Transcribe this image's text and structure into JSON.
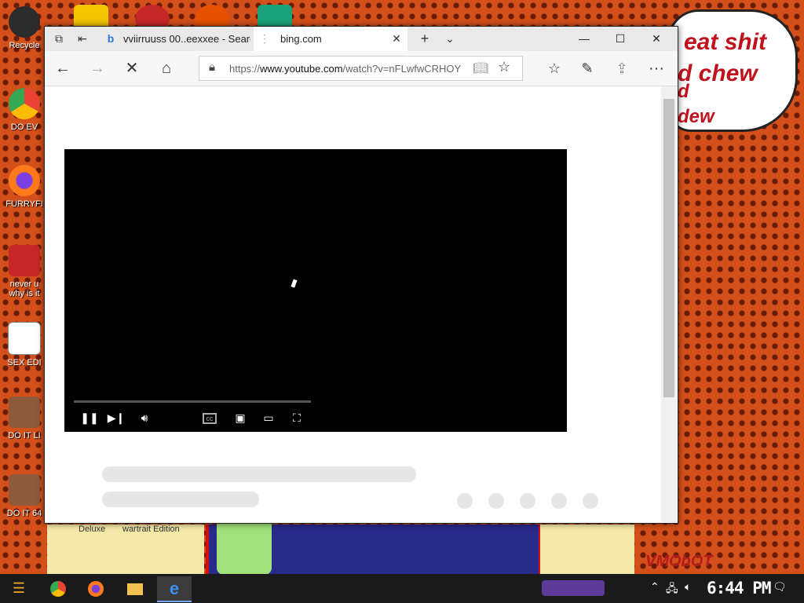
{
  "desktop": {
    "icons": [
      {
        "label": "Recycle",
        "color": "#2b2b2b"
      },
      {
        "label": "DO EV",
        "color": "#1e88e5"
      },
      {
        "label": "FURRYFI",
        "color": "#ff7a1a"
      },
      {
        "label": "never u",
        "label2": "why is it",
        "color": "#c62828"
      },
      {
        "label": "SEX EDI",
        "color": "#2e7d32"
      },
      {
        "label": "DO IT LI",
        "color": "#8d5a3b"
      },
      {
        "label": "DO IT 64",
        "color": "#8d5a3b"
      }
    ],
    "speech_bubble": {
      "line1": "eat shit",
      "line2": "d chew",
      "line3": "d",
      "line4": "dew"
    },
    "wallpaper_texts": {
      "deluxe": "Deluxe",
      "edition": "wartrait Edition",
      "signature": "VMObOT"
    }
  },
  "browser": {
    "tabs": [
      {
        "title": "vviirruuss 00..eexxee - Searc",
        "icon": "bing-icon"
      },
      {
        "title": "bing.com",
        "icon": "loading-icon"
      }
    ],
    "address": {
      "prefix": "https://",
      "host": "www.youtube.com",
      "path": "/watch?v=nFLwfwCRHOY"
    }
  },
  "taskbar": {
    "clock": "6:44 PM",
    "apps": [
      "start",
      "chrome",
      "firefox",
      "folder",
      "explorer",
      "edge"
    ]
  }
}
